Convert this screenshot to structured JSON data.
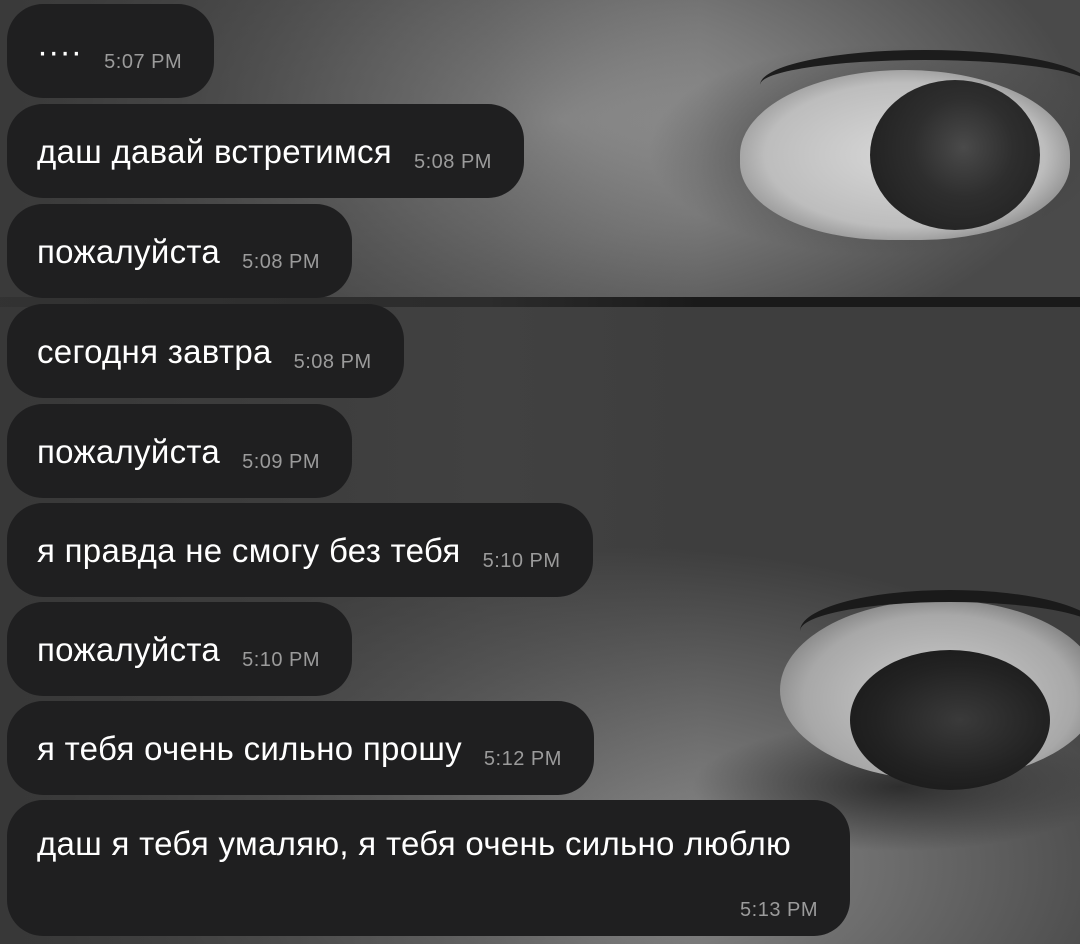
{
  "messages": [
    {
      "text": "····",
      "time": "5:07 PM"
    },
    {
      "text": "даш давай встретимся",
      "time": "5:08 PM"
    },
    {
      "text": "пожалуйста",
      "time": "5:08 PM"
    },
    {
      "text": "сегодня завтра",
      "time": "5:08 PM"
    },
    {
      "text": "пожалуйста",
      "time": "5:09 PM"
    },
    {
      "text": "я правда не смогу без тебя",
      "time": "5:10 PM"
    },
    {
      "text": "пожалуйста",
      "time": "5:10 PM"
    },
    {
      "text": "я тебя очень сильно прошу",
      "time": "5:12 PM"
    },
    {
      "text": "даш я тебя умаляю, я тебя очень сильно люблю",
      "time": "5:13 PM"
    }
  ],
  "colors": {
    "bubble": "#1f1f20",
    "text": "#ffffff",
    "timestamp": "#9b9b9b"
  },
  "wallpaper": {
    "icon": "grayscale-eyes-photo"
  }
}
